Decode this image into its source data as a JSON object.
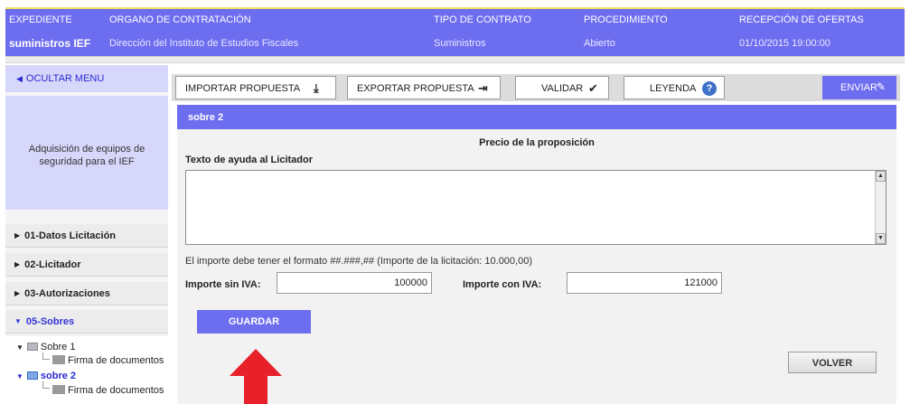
{
  "header": {
    "columns": [
      {
        "label": "EXPEDIENTE",
        "value": "suministros IEF"
      },
      {
        "label": "ORGANO DE CONTRATACIÓN",
        "value": "Dirección del Instituto de Estudios Fiscales"
      },
      {
        "label": "TIPO DE CONTRATO",
        "value": "Suministros"
      },
      {
        "label": "PROCEDIMIENTO",
        "value": "Abierto"
      },
      {
        "label": "RECEPCIÓN DE OFERTAS",
        "value": "01/10/2015 19:00:00"
      }
    ]
  },
  "sidebar": {
    "hide_menu": "OCULTAR MENU",
    "description": "Adquisición de equipos de seguridad para el IEF",
    "items": [
      {
        "label": "01-Datos Licitación"
      },
      {
        "label": "02-Licitador"
      },
      {
        "label": "03-Autorizaciones"
      },
      {
        "label": "05-Sobres"
      }
    ],
    "tree": {
      "sobre1": "Sobre 1",
      "sobre1_child": "Firma de documentos",
      "sobre2": "sobre 2",
      "sobre2_child": "Firma de documentos"
    }
  },
  "toolbar": {
    "import": "IMPORTAR PROPUESTA",
    "export": "EXPORTAR PROPUESTA",
    "validate": "VALIDAR",
    "legend": "LEYENDA",
    "send": "ENVIAR"
  },
  "panel": {
    "title": "sobre 2",
    "section_title": "Precio de la proposición",
    "help_label": "Texto de ayuda al Licitador",
    "help_text": "",
    "format_note": "El importe debe tener el formato ##.###,## (Importe de la licitación: 10.000,00)",
    "amount_without_vat_label": "Importe sin IVA:",
    "amount_without_vat": "100000",
    "amount_with_vat_label": "Importe con IVA:",
    "amount_with_vat": "121000",
    "save": "GUARDAR",
    "back": "VOLVER"
  },
  "colors": {
    "accent": "#6d6df0",
    "highlight_bar": "#f2e25b",
    "annotation_arrow": "#e8202a"
  },
  "icons": [
    "download-icon",
    "export-icon",
    "checkmark-icon",
    "help-icon",
    "edit-send-icon",
    "envelope-icon",
    "folder-icon",
    "red-up-arrow"
  ]
}
